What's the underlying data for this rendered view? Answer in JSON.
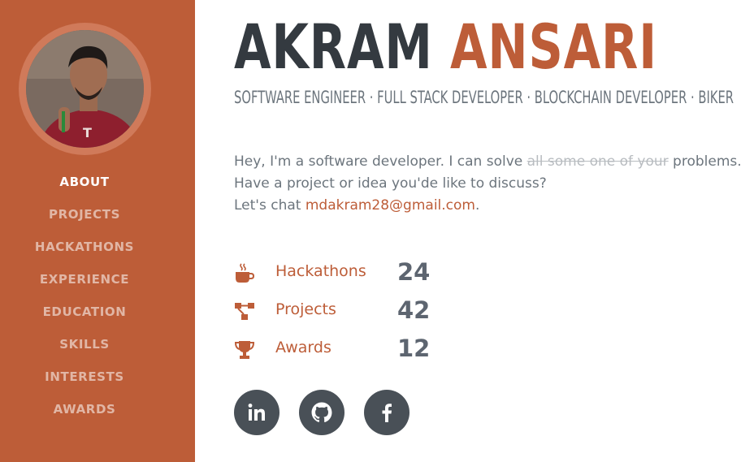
{
  "profile": {
    "photo_alt": "Akram Ansari"
  },
  "nav": {
    "items": [
      {
        "label": "ABOUT",
        "active": true
      },
      {
        "label": "PROJECTS"
      },
      {
        "label": "HACKATHONS"
      },
      {
        "label": "EXPERIENCE"
      },
      {
        "label": "EDUCATION"
      },
      {
        "label": "SKILLS"
      },
      {
        "label": "INTERESTS"
      },
      {
        "label": "AWARDS"
      }
    ]
  },
  "header": {
    "first_name": "AKRAM",
    "last_name": "ANSARI",
    "subheading": "SOFTWARE ENGINEER · FULL STACK DEVELOPER · BLOCKCHAIN DEVELOPER · BIKER"
  },
  "intro": {
    "line1_prefix": "Hey, I'm a software developer. I can solve ",
    "line1_strike": "all some one of your",
    "line1_suffix": " problems.",
    "line2": "Have a project or idea you'de like to discuss?",
    "line3_prefix": "Let's chat ",
    "email": "mdakram28@gmail.com",
    "line3_suffix": "."
  },
  "stats": [
    {
      "icon": "coffee-icon",
      "label": "Hackathons",
      "value": "24"
    },
    {
      "icon": "project-diagram-icon",
      "label": "Projects",
      "value": "42"
    },
    {
      "icon": "trophy-icon",
      "label": "Awards",
      "value": "12"
    }
  ],
  "social": [
    {
      "icon": "linkedin-icon"
    },
    {
      "icon": "github-icon"
    },
    {
      "icon": "facebook-icon"
    }
  ],
  "colors": {
    "accent": "#bd5d38",
    "dark": "#343a40",
    "muted": "#6c757d",
    "social_bg": "#495057"
  }
}
